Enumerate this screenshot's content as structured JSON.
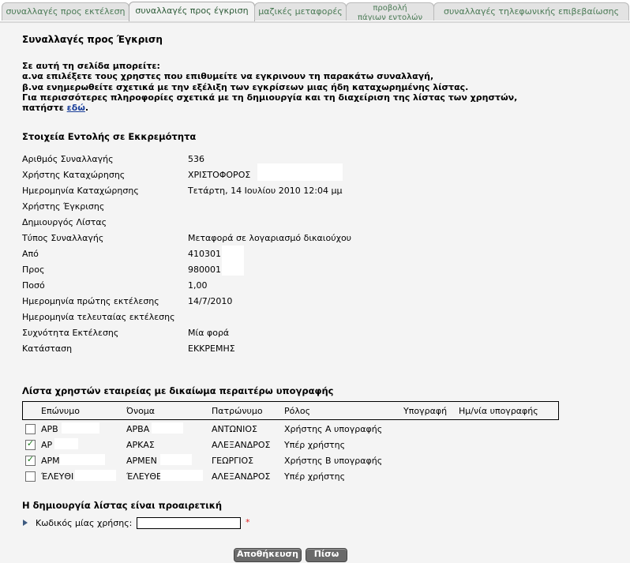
{
  "tabs": [
    {
      "label": "συναλλαγές προς εκτέλεση"
    },
    {
      "label": "συναλλαγές προς έγκριση"
    },
    {
      "label": "μαζικές μεταφορές"
    },
    {
      "label_line1": "προβολή",
      "label_line2": "πάγιων εντολών"
    },
    {
      "label": "συναλλαγές τηλεφωνικής επιβεβαίωσης"
    }
  ],
  "page": {
    "title": "Συναλλαγές προς Έγκριση",
    "intro_line1": "Σε αυτή τη σελίδα μπορείτε:",
    "intro_line2": "α.να επιλέξετε τους χρηστες που επιθυμείτε να εγκρινουν τη παρακάτω συναλλαγή,",
    "intro_line3": "β.να ενημερωθείτε σχετικά με την εξέλιξη των εγκρίσεων μιας ήδη καταχωρημένης λίστας.",
    "intro_line4": "Για περισσότερες πληροφορίες σχετικά με τη δημιουργία και τη διαχείριση της λίστας των χρηστών,",
    "intro_line5_prefix": "πατήστε ",
    "intro_link": "εδώ",
    "intro_line5_suffix": "."
  },
  "details": {
    "heading": "Στοιχεία Εντολής σε Εκκρεμότητα",
    "rows": [
      {
        "label": "Αριθμός Συναλλαγής",
        "value": "536"
      },
      {
        "label": "Χρήστης Καταχώρησης",
        "value": "ΧΡΙΣΤΟΦΟΡΟΣ"
      },
      {
        "label": "Ημερομηνία Καταχώρησης",
        "value": "Τετάρτη, 14 Ιουλίου 2010 12:04 μμ"
      },
      {
        "label": "Χρήστης Έγκρισης",
        "value": ""
      },
      {
        "label": "Δημιουργός Λίστας",
        "value": ""
      },
      {
        "label": "Τύπος Συναλλαγής",
        "value": "Μεταφορά σε λογαριασμό δικαιούχου"
      },
      {
        "label": "Από",
        "value": "410301"
      },
      {
        "label": "Προς",
        "value": "980001"
      },
      {
        "label": "Ποσό",
        "value": "1,00"
      },
      {
        "label": "Ημερομηνία πρώτης εκτέλεσης",
        "value": "14/7/2010"
      },
      {
        "label": "Ημερομηνία τελευταίας εκτέλεσης",
        "value": ""
      },
      {
        "label": "Συχνότητα Εκτέλεσης",
        "value": "Μία φορά"
      },
      {
        "label": "Κατάσταση",
        "value": "ΕΚΚΡΕΜΗΣ"
      }
    ]
  },
  "users": {
    "heading": "Λίστα χρηστών εταιρείας με δικαίωμα περαιτέρω υπογραφής",
    "columns": [
      "Επώνυμο",
      "Όνομα",
      "Πατρώνυμο",
      "Ρόλος",
      "Υπογραφή",
      "Ημ/νία υπογραφής"
    ],
    "rows": [
      {
        "surname": "ΑΡΒ",
        "name": "ΑΡΒΑ",
        "father": "ΑΝΤΩΝΙΟΣ",
        "role": "Χρήστης Α υπογραφής",
        "checked": false
      },
      {
        "surname": "ΑΡ",
        "name": "ΑΡΚΑΣ",
        "father": "ΑΛΕΞΑΝΔΡΟΣ",
        "role": "Υπέρ χρήστης",
        "checked": true
      },
      {
        "surname": "ΑΡΜ",
        "name": "ΑΡΜΕΝ",
        "father": "ΓΕΩΡΓΙΟΣ",
        "role": "Χρήστης Β υπογραφής",
        "checked": true
      },
      {
        "surname": "ΈΛΕΥΘΙ",
        "name": "ΈΛΕΥΘΕ",
        "father": "ΑΛΕΞΑΝΔΡΟΣ",
        "role": "Υπέρ χρήστης",
        "checked": false
      }
    ]
  },
  "optional": {
    "heading": "Η δημιουργία λίστας είναι προαιρετική",
    "password_label": "Κωδικός μίας χρήσης:",
    "password_value": "",
    "required_mark": "*"
  },
  "buttons": {
    "save": "Αποθήκευση",
    "back": "Πίσω"
  },
  "colors": {
    "tab_text": "#4a7a55",
    "link": "#1a3f9a",
    "required": "#e02020",
    "button_bg": "#6a6a6a"
  }
}
